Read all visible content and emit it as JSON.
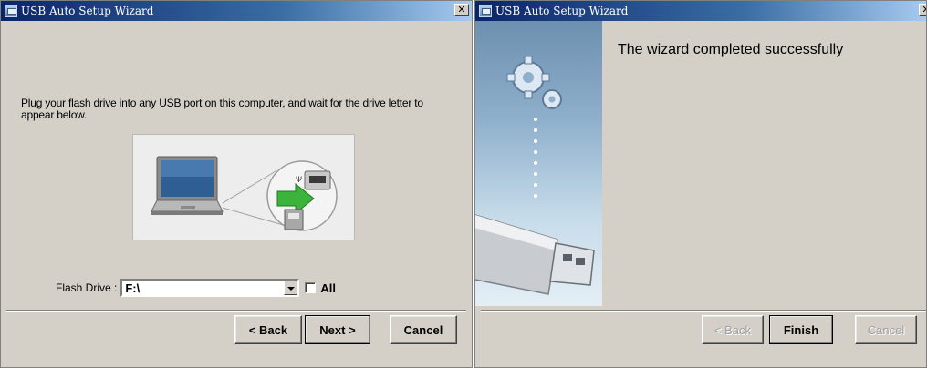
{
  "left_window": {
    "title": "USB Auto Setup Wizard",
    "close_glyph": "✕",
    "instruction": "Plug your flash drive into any USB port on this computer, and wait for the drive letter to appear below.",
    "flash_drive_label": "Flash Drive :",
    "flash_drive_value": "F:\\",
    "all_label": "All",
    "all_checked": false,
    "buttons": {
      "back": "< Back",
      "next": "Next >",
      "cancel": "Cancel"
    }
  },
  "right_window": {
    "title": "USB Auto Setup Wizard",
    "close_glyph": "✕",
    "success_message": "The wizard completed successfully",
    "buttons": {
      "back": "< Back",
      "finish": "Finish",
      "cancel": "Cancel"
    }
  },
  "colors": {
    "titlebar_start": "#0a246a",
    "titlebar_end": "#a6caf0",
    "dialog_face": "#d4d0c8",
    "arrow_green": "#3cb43c"
  },
  "icons": [
    "app-icon",
    "close-icon",
    "laptop-icon",
    "usb-port-icon",
    "green-arrow-icon",
    "gears-icon",
    "usb-stick-icon",
    "dropdown-arrow-icon"
  ]
}
